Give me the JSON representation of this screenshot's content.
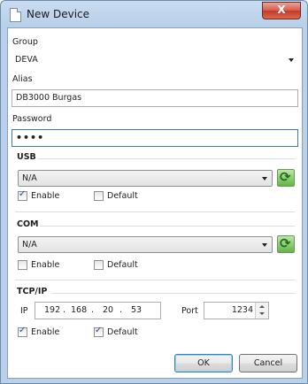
{
  "window": {
    "title": "New Device",
    "close_glyph": "X"
  },
  "group": {
    "label": "Group",
    "value": "DEVA"
  },
  "alias": {
    "label": "Alias",
    "value": "DB3000 Burgas"
  },
  "password": {
    "label": "Password",
    "value": "••••"
  },
  "usb": {
    "title": "USB",
    "port_value": "N/A",
    "enable_label": "Enable",
    "enable_checked": true,
    "default_label": "Default",
    "default_checked": false
  },
  "com": {
    "title": "COM",
    "port_value": "N/A",
    "enable_label": "Enable",
    "enable_checked": false,
    "default_label": "Default",
    "default_checked": false
  },
  "tcpip": {
    "title": "TCP/IP",
    "ip_label": "IP",
    "ip": [
      "192",
      "168",
      "20",
      "53"
    ],
    "port_label": "Port",
    "port_value": "1234",
    "enable_label": "Enable",
    "enable_checked": true,
    "default_label": "Default",
    "default_checked": true
  },
  "buttons": {
    "ok": "OK",
    "cancel": "Cancel"
  }
}
